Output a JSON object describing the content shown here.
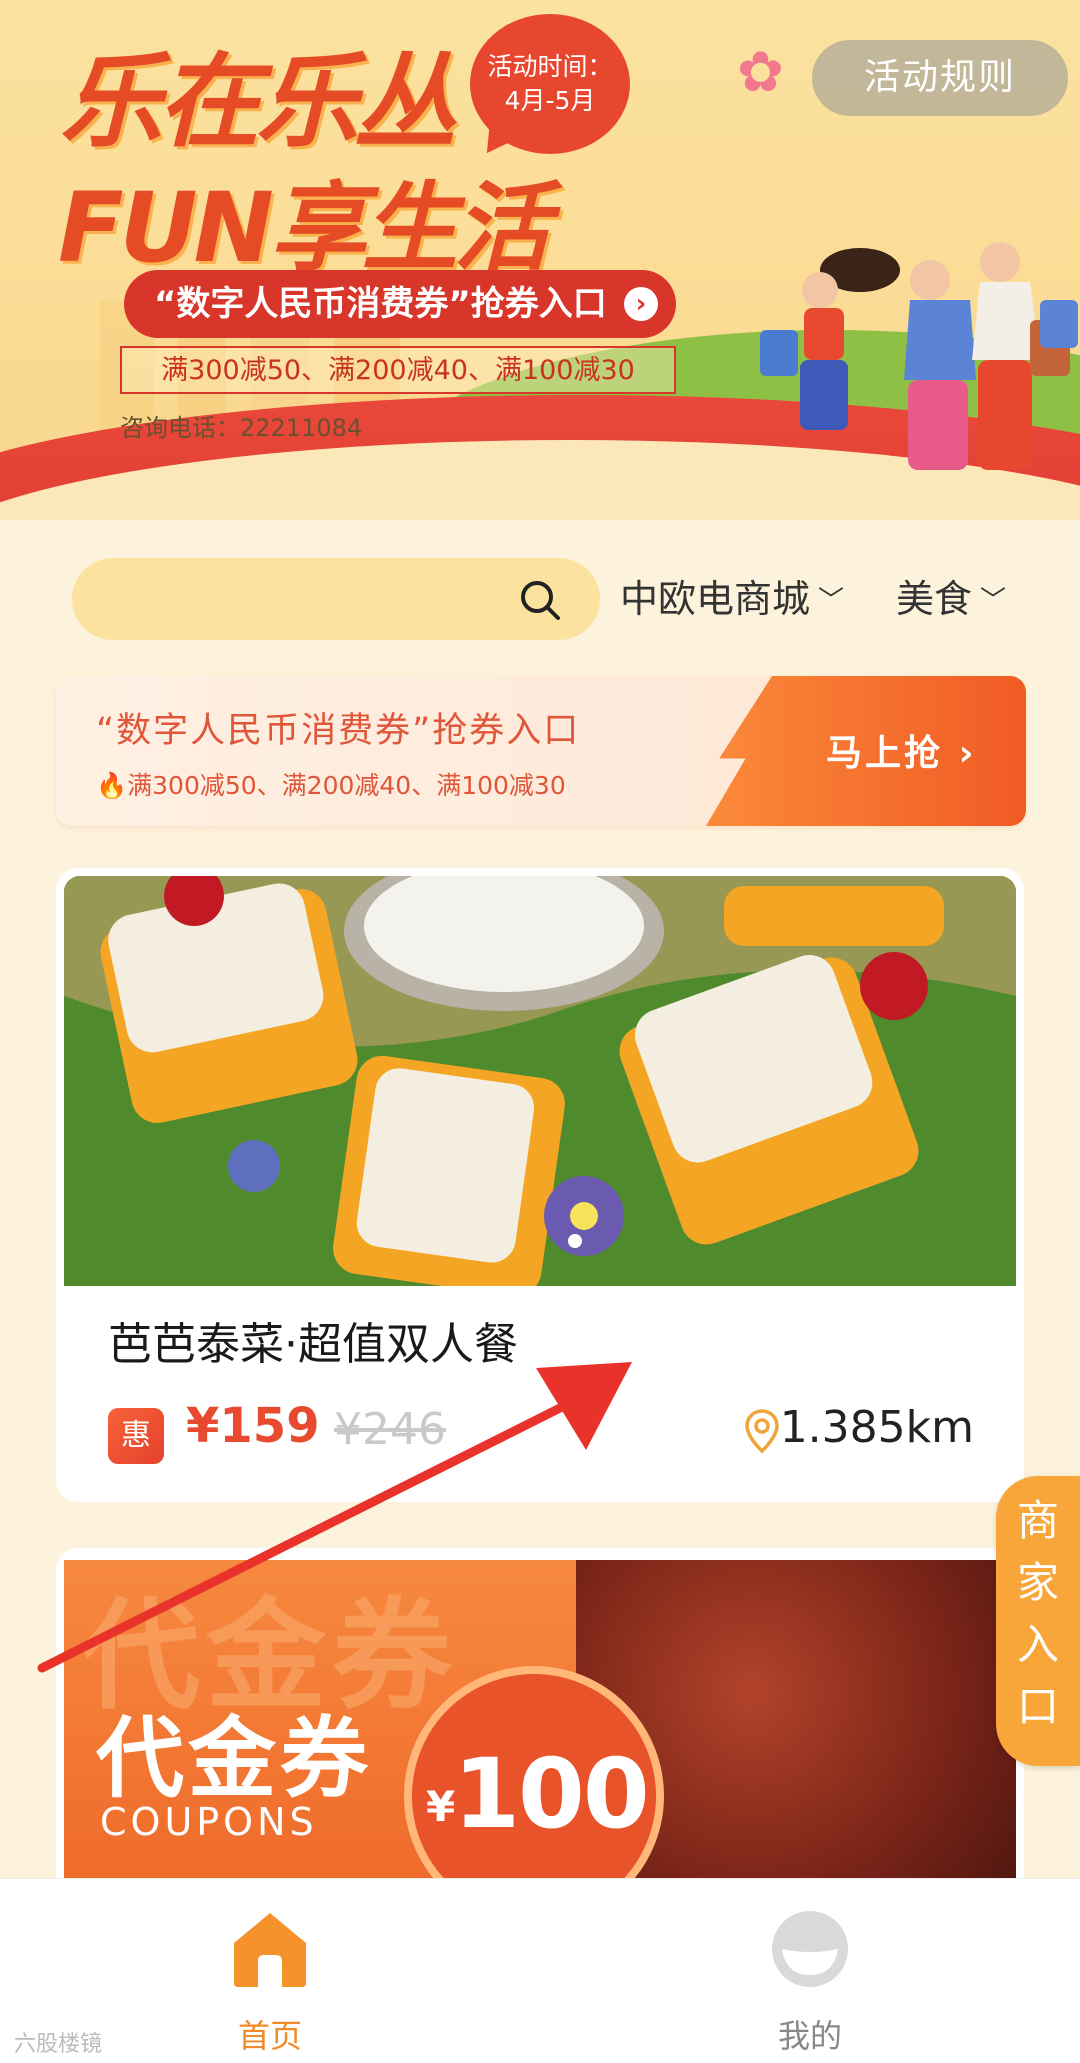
{
  "banner": {
    "title_line1": "乐在乐丛",
    "title_line2": "FUN享生活",
    "activity_time_label": "活动时间：",
    "activity_time_value": "4月-5月",
    "rules_button": "活动规则",
    "coupon_entry": "“数字人民币消费券”抢券入口",
    "coupon_rules": "满300减50、满200减40、满100减30",
    "phone_label": "咨询电话：",
    "phone_number": "22211084"
  },
  "search": {
    "placeholder": "",
    "filter_mall": "中欧电商城",
    "filter_category": "美食"
  },
  "promo": {
    "title": "“数字人民币消费券”抢券入口",
    "rules": "满300减50、满200减40、满100减30",
    "action": "马上抢"
  },
  "product": {
    "name": "芭芭泰菜·超值双人餐",
    "badge": "惠",
    "price": "¥159",
    "original_price": "¥246",
    "distance": "1.385km"
  },
  "voucher": {
    "ghost_text": "代金券",
    "title": "代金券",
    "title_en": "COUPONS",
    "currency": "¥",
    "amount": "100"
  },
  "side_tab": [
    "商",
    "家",
    "入",
    "口"
  ],
  "nav": {
    "home": "首页",
    "mine": "我的"
  },
  "watermark": "六股楼镜",
  "colors": {
    "accent": "#f08a2a",
    "price_red": "#e84a2f",
    "banner_red": "#d8352b"
  }
}
